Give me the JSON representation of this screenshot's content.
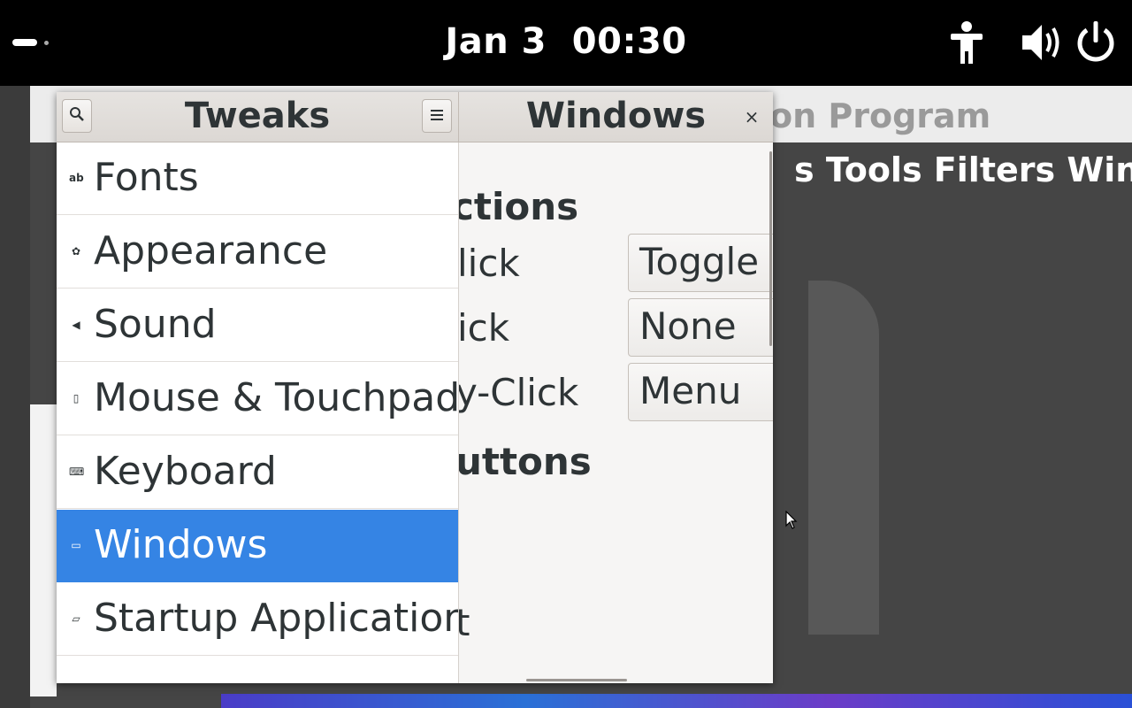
{
  "topbar": {
    "clock": "Jan 3  00:30",
    "icons": [
      "activities-indicator",
      "accessibility-icon",
      "volume-icon",
      "power-icon"
    ]
  },
  "gimp": {
    "title_fragment": "on Program",
    "menu_fragment": "s Tools Filters Wind"
  },
  "tweaks": {
    "sidebar_title": "Tweaks",
    "page_title": "Windows",
    "close_label": "×",
    "menu_label": "≡",
    "sidebar": [
      {
        "icon": "fonts-icon",
        "glyph": "ab",
        "label": "Fonts",
        "selected": false
      },
      {
        "icon": "appearance-icon",
        "glyph": "✿",
        "label": "Appearance",
        "selected": false
      },
      {
        "icon": "sound-icon",
        "glyph": "◀",
        "label": "Sound",
        "selected": false
      },
      {
        "icon": "mouse-icon",
        "glyph": "▯",
        "label": "Mouse & Touchpad",
        "selected": false
      },
      {
        "icon": "keyboard-icon",
        "glyph": "⌨",
        "label": "Keyboard",
        "selected": false
      },
      {
        "icon": "windows-icon",
        "glyph": "▭",
        "label": "Windows",
        "selected": true
      },
      {
        "icon": "startup-folder-icon",
        "glyph": "▱",
        "label": "Startup Applications",
        "selected": false
      }
    ],
    "content": {
      "section_actions": "ctions",
      "row1_label": "lick",
      "row1_value": "Toggle M",
      "row2_label": "ick",
      "row2_value": "None",
      "row3_label": "y-Click",
      "row3_value": "Menu",
      "section_buttons": "uttons",
      "fragment_t": "t"
    }
  }
}
